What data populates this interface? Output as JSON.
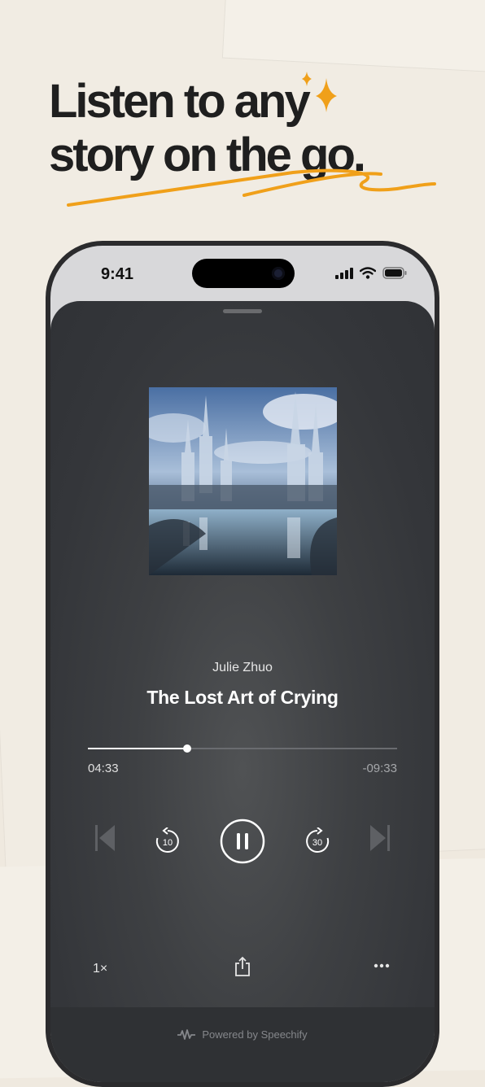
{
  "headline": {
    "line1": "Listen to any",
    "line2": "story on the go."
  },
  "status_bar": {
    "time": "9:41"
  },
  "player": {
    "author": "Julie Zhuo",
    "title": "The Lost Art of Crying",
    "elapsed": "04:33",
    "remaining": "-09:33",
    "progress_fraction": 0.32,
    "skip_back_seconds": "10",
    "skip_forward_seconds": "30",
    "speed_label": "1×"
  },
  "footer": {
    "powered_by": "Powered by Speechify"
  },
  "icons": {
    "sparkle": "sparkle-icon",
    "underline": "scribble-underline",
    "signal": "cellular-signal-icon",
    "wifi": "wifi-icon",
    "battery": "battery-icon",
    "previous": "skip-previous-icon",
    "rewind": "rewind-10-icon",
    "pause": "pause-icon",
    "forward": "forward-30-icon",
    "next": "skip-next-icon",
    "share": "share-icon",
    "more": "more-icon",
    "speechify": "speechify-logo-icon"
  },
  "colors": {
    "accent": "#f0a01a",
    "sheet": "#3a3c40",
    "text_primary": "#ffffff"
  }
}
